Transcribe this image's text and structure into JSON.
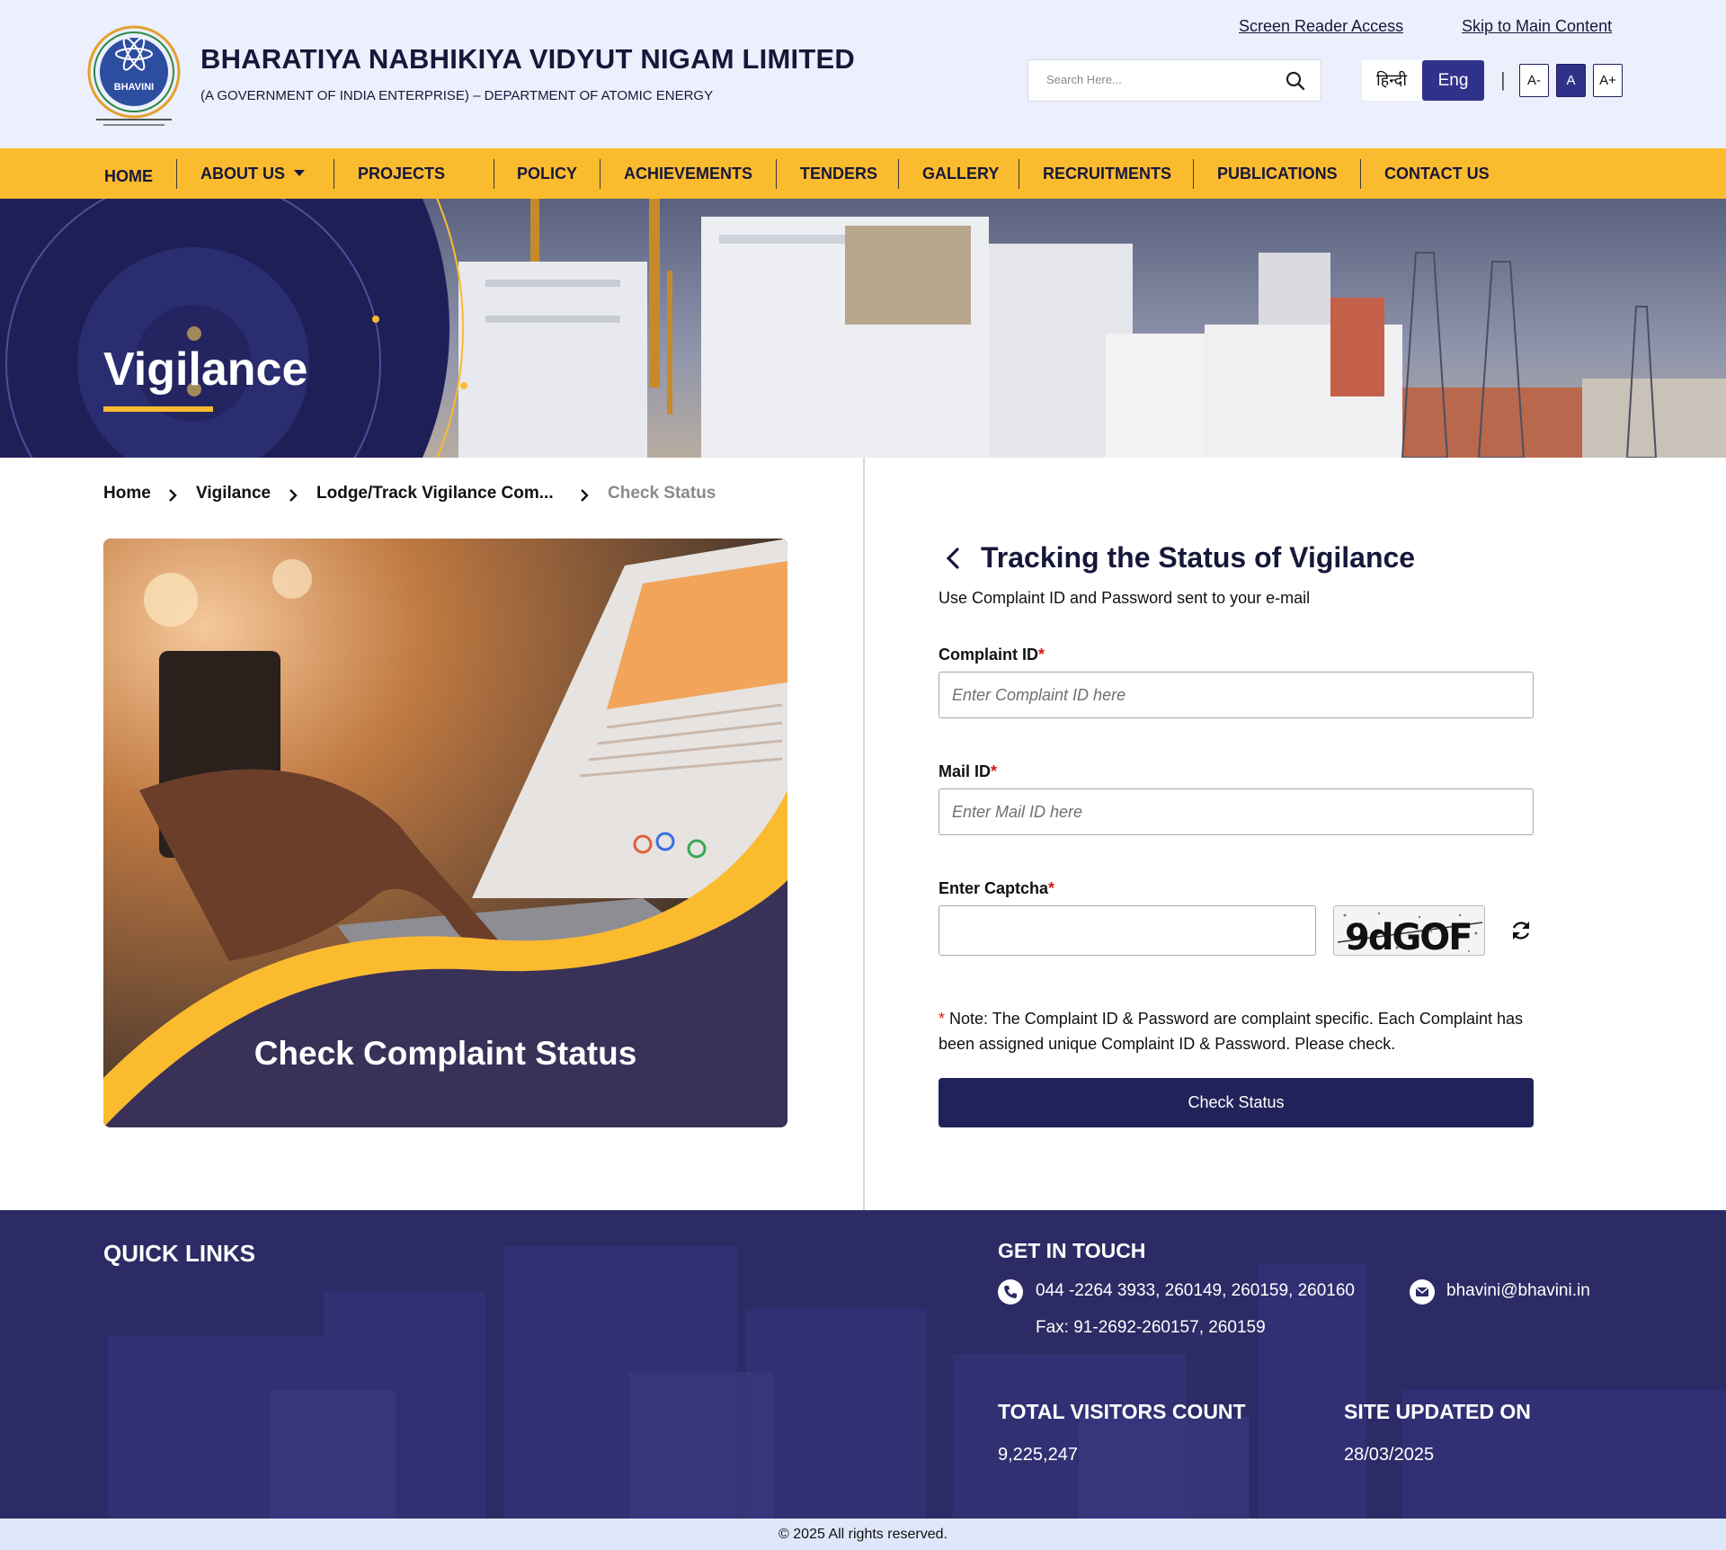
{
  "header": {
    "org_name": "BHARATIYA NABHIKIYA VIDYUT NIGAM LIMITED",
    "org_subtitle": "(A GOVERNMENT OF INDIA ENTERPRISE) – DEPARTMENT OF ATOMIC ENERGY",
    "logo_text": "BHAVINI",
    "screen_reader_link": "Screen Reader Access",
    "skip_link": "Skip to Main Content",
    "search_placeholder": "Search Here...",
    "lang_hindi": "हिन्दी",
    "lang_english": "Eng",
    "font_smaller": "A-",
    "font_normal": "A",
    "font_larger": "A+",
    "separator": "|"
  },
  "nav": {
    "items": [
      "HOME",
      "ABOUT US",
      "PROJECTS",
      "POLICY",
      "ACHIEVEMENTS",
      "TENDERS",
      "GALLERY",
      "RECRUITMENTS",
      "PUBLICATIONS",
      "CONTACT US"
    ]
  },
  "hero": {
    "title": "Vigilance"
  },
  "breadcrumb": [
    "Home",
    "Vigilance",
    "Lodge/Track Vigilance Com...",
    "Check Status"
  ],
  "card": {
    "title": "Check Complaint Status"
  },
  "form": {
    "title": "Tracking the Status of Vigilance",
    "subtitle": "Use Complaint ID and Password sent to your e-mail",
    "complaint_label": "Complaint ID",
    "complaint_placeholder": "Enter Complaint ID here",
    "mail_label": "Mail ID",
    "mail_placeholder": "Enter Mail ID here",
    "captcha_label": "Enter Captcha",
    "captcha_text": "9dGOF",
    "required_mark": "*",
    "note": "Note: The Complaint ID & Password are complaint specific. Each Complaint has been assigned unique Complaint ID & Password. Please check.",
    "submit_label": "Check Status"
  },
  "footer": {
    "quick_links_title": "QUICK LINKS",
    "get_in_touch_title": "GET IN TOUCH",
    "phone": "044 -2264 3933, 260149, 260159, 260160",
    "fax": "Fax: 91-2692-260157, 260159",
    "email": "bhavini@bhavini.in",
    "visitors_title": "TOTAL VISITORS COUNT",
    "visitors_count": "9,225,247",
    "updated_title": "SITE UPDATED ON",
    "updated_date": "28/03/2025",
    "copyright": "© 2025 All rights reserved."
  },
  "colors": {
    "navy": "#22225a",
    "accent_yellow": "#fbbb2f",
    "header_bg": "#eceffc",
    "footer_bg": "#2c2b65",
    "required_red": "#d11a1a"
  },
  "icons": [
    "bhavini-logo-icon",
    "search-icon",
    "caret-down-icon",
    "chevron-right-icon",
    "chevron-left-icon",
    "refresh-icon",
    "phone-icon",
    "mail-icon"
  ]
}
